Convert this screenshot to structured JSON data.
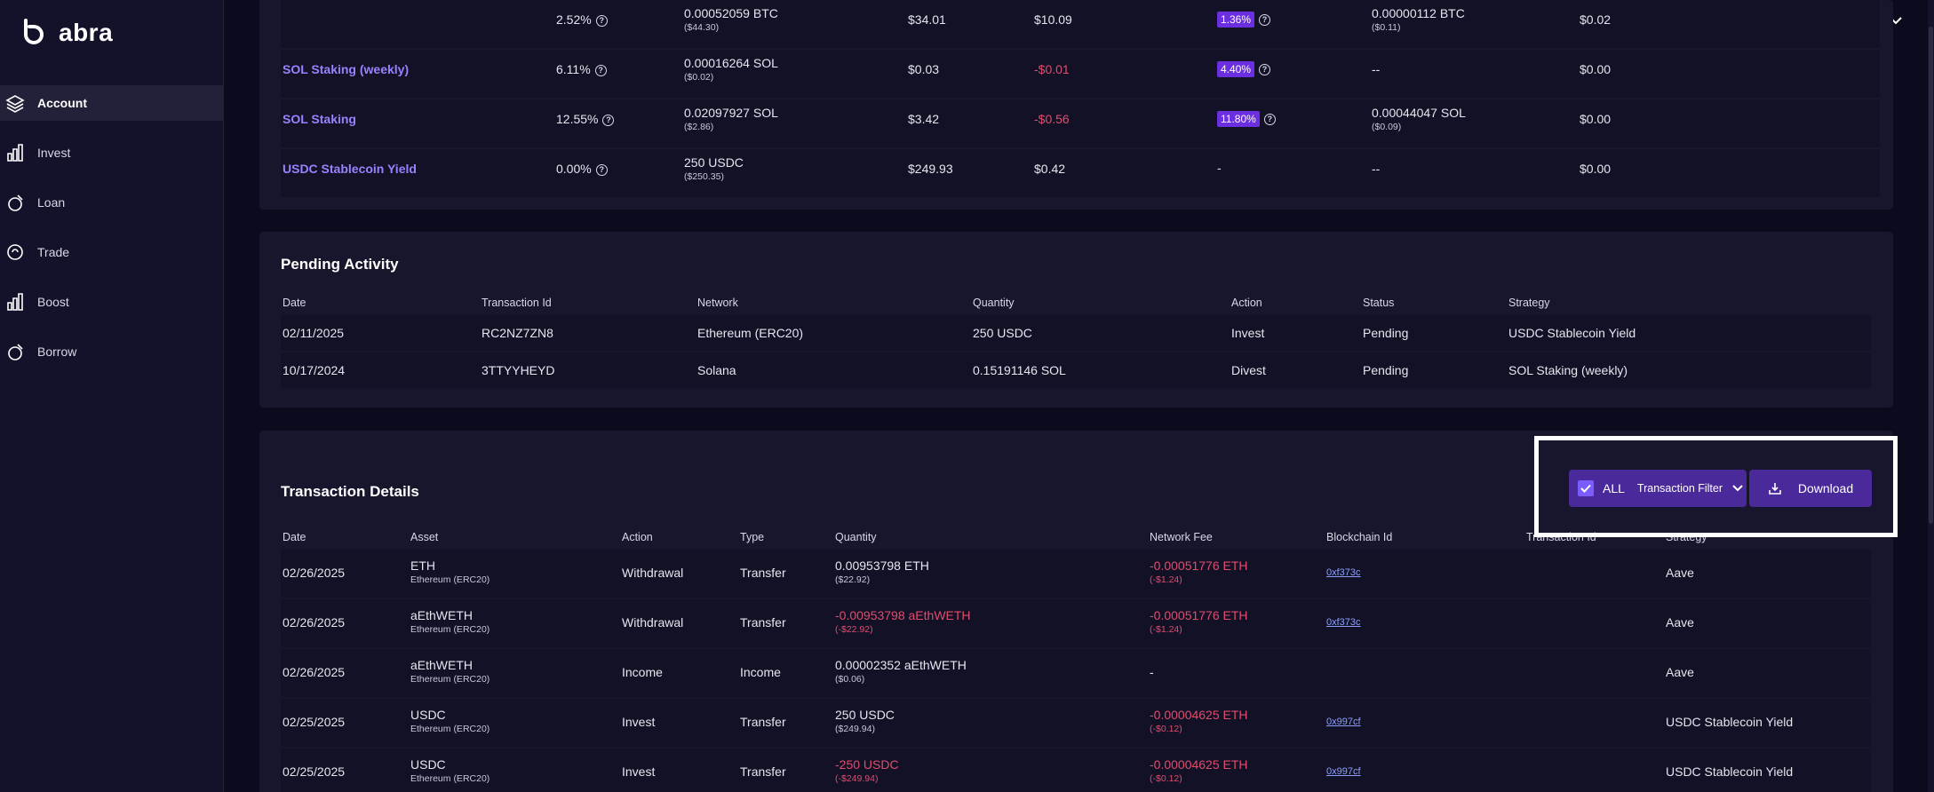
{
  "brand": {
    "name": "abra"
  },
  "nav": [
    {
      "label": "Account",
      "icon": "layers-icon",
      "active": true
    },
    {
      "label": "Invest",
      "icon": "bar-chart-icon",
      "active": false
    },
    {
      "label": "Loan",
      "icon": "loan-icon",
      "active": false
    },
    {
      "label": "Trade",
      "icon": "trade-icon",
      "active": false
    },
    {
      "label": "Boost",
      "icon": "boost-chart-icon",
      "active": false
    },
    {
      "label": "Borrow",
      "icon": "borrow-icon",
      "active": false
    }
  ],
  "strategies": {
    "rows": [
      {
        "name": "",
        "apy": "2.52%",
        "qty": "0.00052059 BTC",
        "qty_usd": "($44.30)",
        "c1": "$34.01",
        "c2": "$10.09",
        "badge": "1.36%",
        "earned": "0.00000112 BTC",
        "earned_usd": "($0.11)",
        "c3": "$0.02"
      },
      {
        "name": "SOL Staking (weekly)",
        "apy": "6.11%",
        "qty": "0.00016264 SOL",
        "qty_usd": "($0.02)",
        "c1": "$0.03",
        "c2": "-$0.01",
        "badge": "4.40%",
        "earned": "--",
        "earned_usd": "",
        "c3": "$0.00"
      },
      {
        "name": "SOL Staking",
        "apy": "12.55%",
        "qty": "0.02097927 SOL",
        "qty_usd": "($2.86)",
        "c1": "$3.42",
        "c2": "-$0.56",
        "badge": "11.80%",
        "earned": "0.00044047 SOL",
        "earned_usd": "($0.09)",
        "c3": "$0.00"
      },
      {
        "name": "USDC Stablecoin Yield",
        "apy": "0.00%",
        "qty": "250 USDC",
        "qty_usd": "($250.35)",
        "c1": "$249.93",
        "c2": "$0.42",
        "badge": "-",
        "earned": "--",
        "earned_usd": "",
        "c3": "$0.00"
      }
    ]
  },
  "pending": {
    "title": "Pending Activity",
    "headers": [
      "Date",
      "Transaction Id",
      "Network",
      "Quantity",
      "Action",
      "Status",
      "Strategy"
    ],
    "rows": [
      [
        "02/11/2025",
        "RC2NZ7ZN8",
        "Ethereum (ERC20)",
        "250 USDC",
        "Invest",
        "Pending",
        "USDC Stablecoin Yield"
      ],
      [
        "10/17/2024",
        "3TTYYHEYD",
        "Solana",
        "0.15191146 SOL",
        "Divest",
        "Pending",
        "SOL Staking (weekly)"
      ]
    ]
  },
  "transactions": {
    "title": "Transaction Details",
    "filter_all": "ALL",
    "filter_label": "Transaction Filter",
    "download_label": "Download",
    "headers": [
      "Date",
      "Asset",
      "Action",
      "Type",
      "Quantity",
      "Network Fee",
      "Blockchain Id",
      "Transaction Id",
      "Strategy"
    ],
    "rows": [
      {
        "date": "02/26/2025",
        "asset": "ETH",
        "network": "Ethereum (ERC20)",
        "action": "Withdrawal",
        "type": "Transfer",
        "qty": "0.00953798 ETH",
        "qty_usd": "($22.92)",
        "qty_neg": false,
        "fee": "-0.00051776 ETH",
        "fee_usd": "(-$1.24)",
        "chain": "0xf373c",
        "strategy": "Aave"
      },
      {
        "date": "02/26/2025",
        "asset": "aEthWETH",
        "network": "Ethereum (ERC20)",
        "action": "Withdrawal",
        "type": "Transfer",
        "qty": "-0.00953798 aEthWETH",
        "qty_usd": "(-$22.92)",
        "qty_neg": true,
        "fee": "-0.00051776 ETH",
        "fee_usd": "(-$1.24)",
        "chain": "0xf373c",
        "strategy": "Aave"
      },
      {
        "date": "02/26/2025",
        "asset": "aEthWETH",
        "network": "Ethereum (ERC20)",
        "action": "Income",
        "type": "Income",
        "qty": "0.00002352 aEthWETH",
        "qty_usd": "($0.06)",
        "qty_neg": false,
        "fee": "-",
        "fee_usd": "",
        "chain": "",
        "strategy": "Aave"
      },
      {
        "date": "02/25/2025",
        "asset": "USDC",
        "network": "Ethereum (ERC20)",
        "action": "Invest",
        "type": "Transfer",
        "qty": "250 USDC",
        "qty_usd": "($249.94)",
        "qty_neg": false,
        "fee": "-0.00004625 ETH",
        "fee_usd": "(-$0.12)",
        "chain": "0x997cf",
        "strategy": "USDC Stablecoin Yield"
      },
      {
        "date": "02/25/2025",
        "asset": "USDC",
        "network": "Ethereum (ERC20)",
        "action": "Invest",
        "type": "Transfer",
        "qty": "-250 USDC",
        "qty_usd": "(-$249.94)",
        "qty_neg": true,
        "fee": "-0.00004625 ETH",
        "fee_usd": "(-$0.12)",
        "chain": "0x997cf",
        "strategy": "USDC Stablecoin Yield"
      }
    ]
  },
  "colors": {
    "accent": "#6b2ee0",
    "link": "#9a82ff",
    "negative": "#e14d6f",
    "panel": "#17162d",
    "background": "#0c0b1d"
  }
}
